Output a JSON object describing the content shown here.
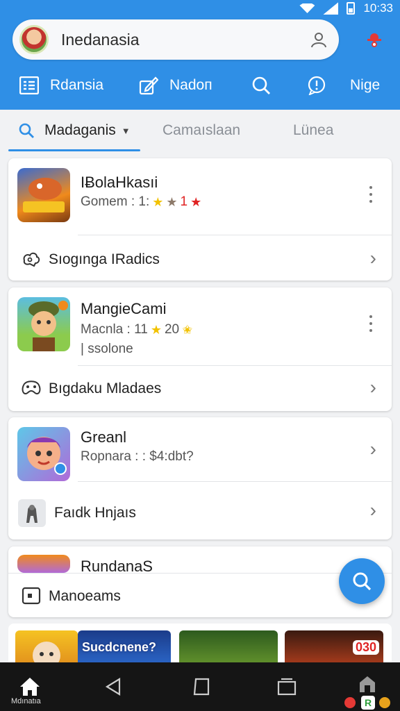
{
  "status": {
    "time": "10:33"
  },
  "header": {
    "search_title": "Inedanasia",
    "nav": [
      {
        "label": "Rdansia",
        "icon": "list-icon"
      },
      {
        "label": "Nadoп",
        "icon": "edit-icon"
      },
      {
        "label": "",
        "icon": "search-icon"
      },
      {
        "label": "Nige",
        "icon": "chat-icon"
      }
    ]
  },
  "tabs": [
    {
      "label": "Madaganis",
      "active": true
    },
    {
      "label": "Camaıslaan",
      "active": false
    },
    {
      "label": "Lünea",
      "active": false
    }
  ],
  "cards": [
    {
      "title": "IɃolaHkasıi",
      "meta": "Gomem : 1:",
      "meta_suffix": "1",
      "extra": "",
      "sub_label": "Sıogınga IRadics",
      "sub_icon": "puzzle-icon"
    },
    {
      "title": "MangieCami",
      "meta": "Macnla : 11",
      "meta_suffix": "20",
      "extra": "| ssolone",
      "sub_label": "Bıgdaku Mladaes",
      "sub_icon": "gamepad-icon"
    },
    {
      "title": "Greanl",
      "meta": "Ropnara : : $4:dbt?",
      "meta_suffix": "",
      "extra": "",
      "sub_label": "Faıdk Hnjaıs",
      "sub_icon": "character-icon"
    },
    {
      "title": "RundanaS",
      "meta": "",
      "meta_suffix": "",
      "extra": "",
      "sub_label": "Manoeams",
      "sub_icon": "tv-icon"
    }
  ],
  "strip": [
    {
      "text": "",
      "badge": ""
    },
    {
      "text": "Sucdcnene?",
      "badge": ""
    },
    {
      "text": "",
      "badge": ""
    },
    {
      "text": "",
      "badge": "030"
    }
  ],
  "bottom": {
    "home_label": "Mdınatıa"
  },
  "colors": {
    "primary": "#2f8fe6",
    "background": "#f1f2f4",
    "star_yellow": "#f2c200",
    "star_red": "#e02424"
  }
}
